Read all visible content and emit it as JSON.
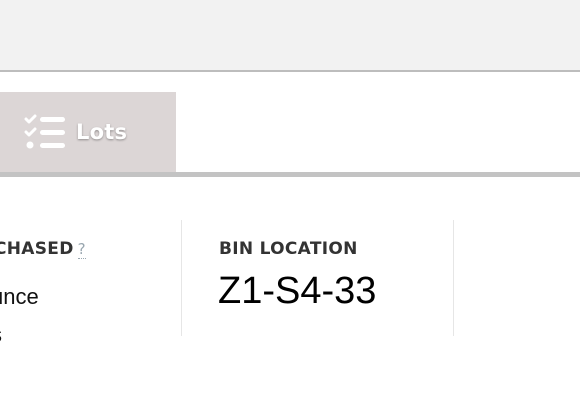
{
  "tabs": {
    "lots": {
      "label": "Lots",
      "icon": "checklist-icon"
    }
  },
  "fields": {
    "purchased": {
      "label": "CHASED",
      "help": "?",
      "lines": [
        "unce",
        "s"
      ]
    },
    "bin_location": {
      "label": "BIN LOCATION",
      "value": "Z1-S4-33"
    }
  },
  "colors": {
    "tab_background": "#dcd6d6",
    "top_bar": "#f2f2f2",
    "divider": "#c3c3c3"
  }
}
